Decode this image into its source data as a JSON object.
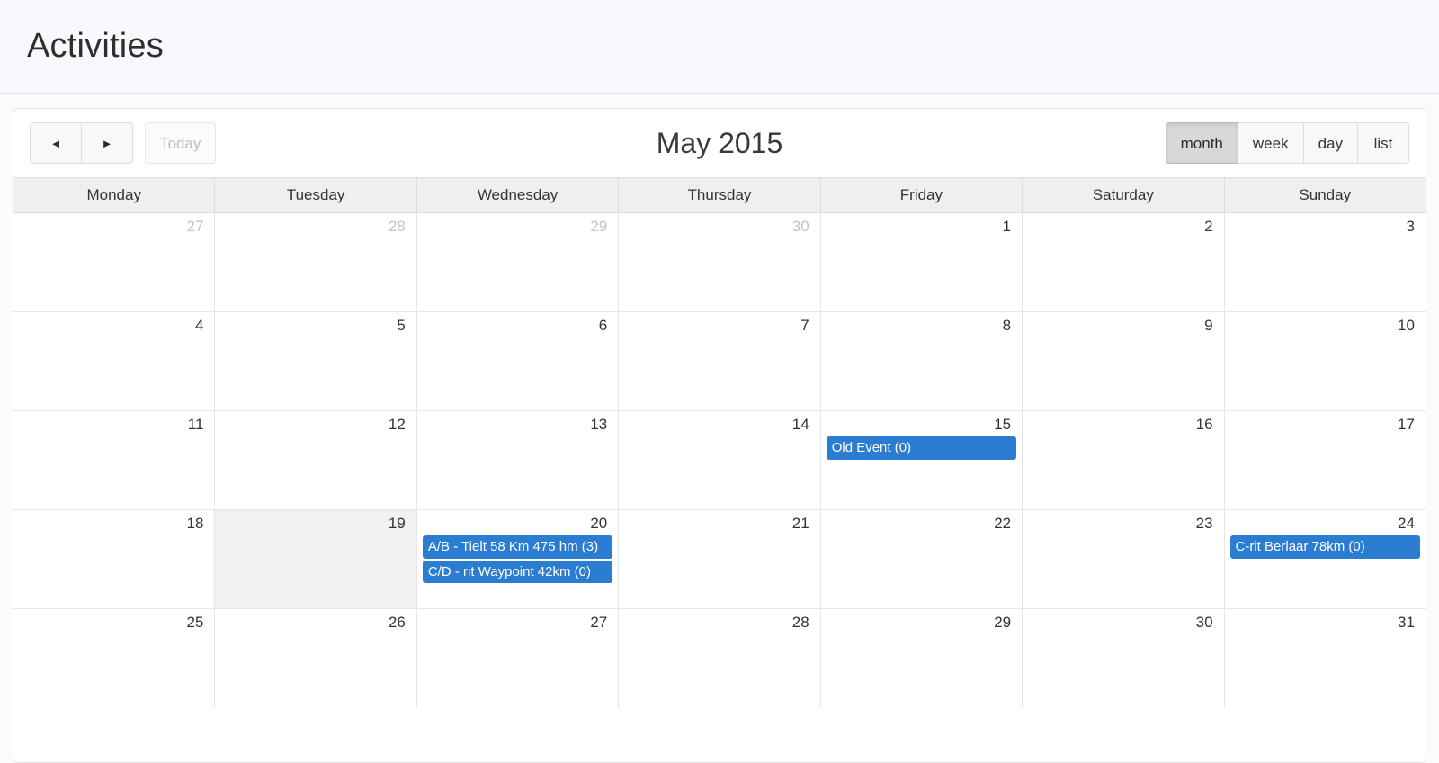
{
  "page": {
    "title": "Activities"
  },
  "toolbar": {
    "prev_label": "◄",
    "next_label": "►",
    "today_label": "Today",
    "title": "May 2015",
    "views": [
      {
        "id": "month",
        "label": "month",
        "active": true
      },
      {
        "id": "week",
        "label": "week",
        "active": false
      },
      {
        "id": "day",
        "label": "day",
        "active": false
      },
      {
        "id": "list",
        "label": "list",
        "active": false
      }
    ]
  },
  "calendar": {
    "day_headers": [
      "Monday",
      "Tuesday",
      "Wednesday",
      "Thursday",
      "Friday",
      "Saturday",
      "Sunday"
    ],
    "event_color": "#2b7dd1",
    "today_highlight_color": "#f1f1f1",
    "weeks": [
      {
        "days": [
          {
            "num": "27",
            "other_month": true,
            "today": false,
            "events": []
          },
          {
            "num": "28",
            "other_month": true,
            "today": false,
            "events": []
          },
          {
            "num": "29",
            "other_month": true,
            "today": false,
            "events": []
          },
          {
            "num": "30",
            "other_month": true,
            "today": false,
            "events": []
          },
          {
            "num": "1",
            "other_month": false,
            "today": false,
            "events": []
          },
          {
            "num": "2",
            "other_month": false,
            "today": false,
            "events": []
          },
          {
            "num": "3",
            "other_month": false,
            "today": false,
            "events": []
          }
        ]
      },
      {
        "days": [
          {
            "num": "4",
            "other_month": false,
            "today": false,
            "events": []
          },
          {
            "num": "5",
            "other_month": false,
            "today": false,
            "events": []
          },
          {
            "num": "6",
            "other_month": false,
            "today": false,
            "events": []
          },
          {
            "num": "7",
            "other_month": false,
            "today": false,
            "events": []
          },
          {
            "num": "8",
            "other_month": false,
            "today": false,
            "events": []
          },
          {
            "num": "9",
            "other_month": false,
            "today": false,
            "events": []
          },
          {
            "num": "10",
            "other_month": false,
            "today": false,
            "events": []
          }
        ]
      },
      {
        "days": [
          {
            "num": "11",
            "other_month": false,
            "today": false,
            "events": []
          },
          {
            "num": "12",
            "other_month": false,
            "today": false,
            "events": []
          },
          {
            "num": "13",
            "other_month": false,
            "today": false,
            "events": []
          },
          {
            "num": "14",
            "other_month": false,
            "today": false,
            "events": []
          },
          {
            "num": "15",
            "other_month": false,
            "today": false,
            "events": [
              "Old Event (0)"
            ]
          },
          {
            "num": "16",
            "other_month": false,
            "today": false,
            "events": []
          },
          {
            "num": "17",
            "other_month": false,
            "today": false,
            "events": []
          }
        ]
      },
      {
        "days": [
          {
            "num": "18",
            "other_month": false,
            "today": false,
            "events": []
          },
          {
            "num": "19",
            "other_month": false,
            "today": true,
            "events": []
          },
          {
            "num": "20",
            "other_month": false,
            "today": false,
            "events": [
              "A/B - Tielt 58 Km 475 hm (3)",
              "C/D - rit Waypoint 42km (0)"
            ]
          },
          {
            "num": "21",
            "other_month": false,
            "today": false,
            "events": []
          },
          {
            "num": "22",
            "other_month": false,
            "today": false,
            "events": []
          },
          {
            "num": "23",
            "other_month": false,
            "today": false,
            "events": []
          },
          {
            "num": "24",
            "other_month": false,
            "today": false,
            "events": [
              "C-rit Berlaar 78km (0)"
            ]
          }
        ]
      },
      {
        "days": [
          {
            "num": "25",
            "other_month": false,
            "today": false,
            "events": []
          },
          {
            "num": "26",
            "other_month": false,
            "today": false,
            "events": []
          },
          {
            "num": "27",
            "other_month": false,
            "today": false,
            "events": []
          },
          {
            "num": "28",
            "other_month": false,
            "today": false,
            "events": []
          },
          {
            "num": "29",
            "other_month": false,
            "today": false,
            "events": []
          },
          {
            "num": "30",
            "other_month": false,
            "today": false,
            "events": []
          },
          {
            "num": "31",
            "other_month": false,
            "today": false,
            "events": []
          }
        ]
      }
    ]
  }
}
